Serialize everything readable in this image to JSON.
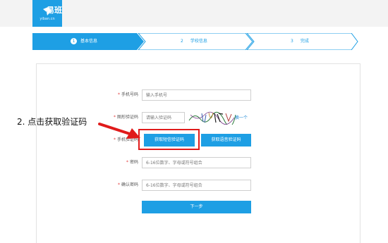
{
  "brand": {
    "name": "易班",
    "domain": "yiban.cn"
  },
  "steps": [
    {
      "num": "1",
      "label": "基本信息",
      "active": true
    },
    {
      "num": "2",
      "label": "学校信息",
      "active": false
    },
    {
      "num": "3",
      "label": "完成",
      "active": false
    }
  ],
  "form": {
    "phone": {
      "label": "手机号码",
      "placeholder": "输入手机号"
    },
    "captcha": {
      "label": "图形验证码",
      "placeholder": "请输入验证码",
      "refresh": "换一个"
    },
    "sms": {
      "label": "手机验证码",
      "sms_button": "获取短信验证码",
      "voice_button": "获取语音验证码"
    },
    "password": {
      "label": "密码",
      "placeholder": "6-16位数字、字母或符号组合"
    },
    "confirm": {
      "label": "确认密码",
      "placeholder": "6-16位数字、字母或符号组合"
    },
    "next_button": "下一步"
  },
  "annotation": "2. 点击获取验证码",
  "colors": {
    "accent": "#1e9fe4",
    "highlight": "#e01b1b",
    "required": "#e23b3b"
  }
}
